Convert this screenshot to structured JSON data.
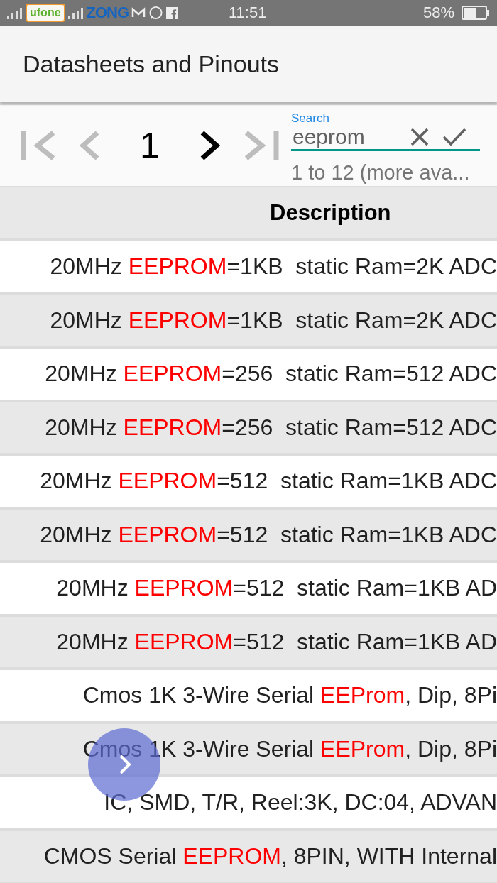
{
  "status_bar": {
    "carrier_1": "ufone",
    "carrier_2": "ZONG",
    "time": "11:51",
    "battery": "58%"
  },
  "app_bar": {
    "title": "Datasheets and Pinouts"
  },
  "pager": {
    "buttons": [
      {
        "kind": "first",
        "disabled": true
      },
      {
        "kind": "prev",
        "disabled": true
      },
      {
        "kind": "page",
        "label": "1"
      },
      {
        "kind": "next",
        "disabled": false
      },
      {
        "kind": "last",
        "disabled": true
      }
    ]
  },
  "search": {
    "label": "Search",
    "value": "eeprom",
    "result_info": "1 to 12 (more ava..."
  },
  "table": {
    "columns": [
      "Description"
    ],
    "rows": [
      {
        "parts": [
          {
            "text": "20MHz ",
            "highlight": false
          },
          {
            "text": "EEPROM",
            "highlight": true
          },
          {
            "text": "=1KB  static Ram=2K ADC",
            "highlight": false
          }
        ]
      },
      {
        "parts": [
          {
            "text": "20MHz ",
            "highlight": false
          },
          {
            "text": "EEPROM",
            "highlight": true
          },
          {
            "text": "=1KB  static Ram=2K ADC",
            "highlight": false
          }
        ]
      },
      {
        "parts": [
          {
            "text": "20MHz ",
            "highlight": false
          },
          {
            "text": "EEPROM",
            "highlight": true
          },
          {
            "text": "=256  static Ram=512 ADC",
            "highlight": false
          }
        ]
      },
      {
        "parts": [
          {
            "text": "20MHz ",
            "highlight": false
          },
          {
            "text": "EEPROM",
            "highlight": true
          },
          {
            "text": "=256  static Ram=512 ADC",
            "highlight": false
          }
        ]
      },
      {
        "parts": [
          {
            "text": "20MHz ",
            "highlight": false
          },
          {
            "text": "EEPROM",
            "highlight": true
          },
          {
            "text": "=512  static Ram=1KB ADC",
            "highlight": false
          }
        ]
      },
      {
        "parts": [
          {
            "text": "20MHz ",
            "highlight": false
          },
          {
            "text": "EEPROM",
            "highlight": true
          },
          {
            "text": "=512  static Ram=1KB ADC",
            "highlight": false
          }
        ]
      },
      {
        "parts": [
          {
            "text": "20MHz ",
            "highlight": false
          },
          {
            "text": "EEPROM",
            "highlight": true
          },
          {
            "text": "=512  static Ram=1KB AD",
            "highlight": false
          }
        ]
      },
      {
        "parts": [
          {
            "text": "20MHz ",
            "highlight": false
          },
          {
            "text": "EEPROM",
            "highlight": true
          },
          {
            "text": "=512  static Ram=1KB AD",
            "highlight": false
          }
        ]
      },
      {
        "parts": [
          {
            "text": "Cmos 1K 3-Wire Serial ",
            "highlight": false
          },
          {
            "text": "EEProm",
            "highlight": true
          },
          {
            "text": ", Dip, 8Pi",
            "highlight": false
          }
        ]
      },
      {
        "parts": [
          {
            "text": "Cmos 1K 3-Wire Serial ",
            "highlight": false
          },
          {
            "text": "EEProm",
            "highlight": true
          },
          {
            "text": ", Dip, 8Pi",
            "highlight": false
          }
        ]
      },
      {
        "parts": [
          {
            "text": "IC, SMD, T/R, Reel:3K, DC:04, ADVAN",
            "highlight": false
          }
        ]
      },
      {
        "parts": [
          {
            "text": "CMOS Serial ",
            "highlight": false
          },
          {
            "text": "EEPROM",
            "highlight": true
          },
          {
            "text": ", 8PIN, WITH Internal",
            "highlight": false
          }
        ]
      }
    ]
  }
}
